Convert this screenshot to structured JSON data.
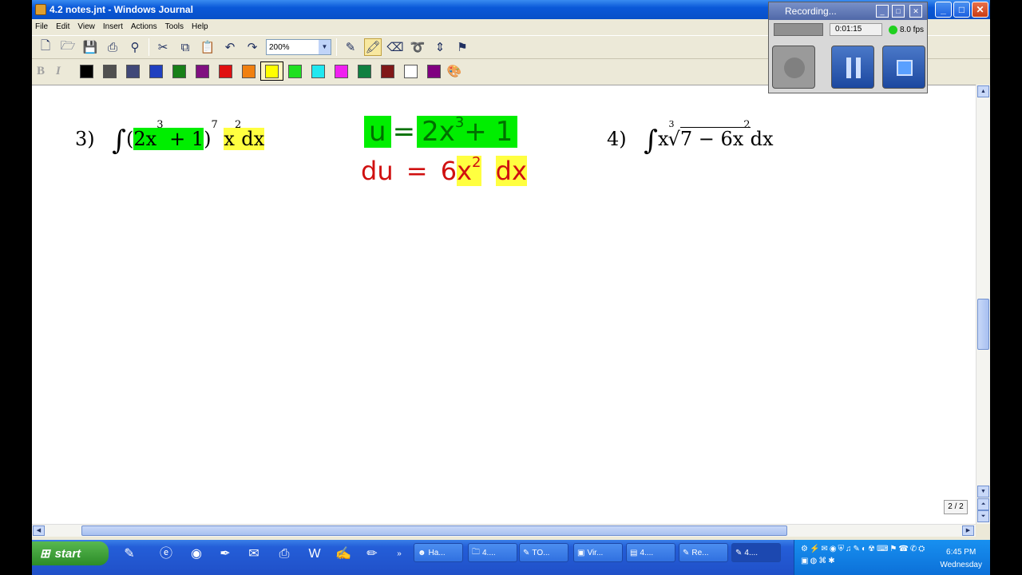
{
  "window": {
    "title": "4.2 notes.jnt - Windows Journal"
  },
  "menu": [
    "File",
    "Edit",
    "View",
    "Insert",
    "Actions",
    "Tools",
    "Help"
  ],
  "toolbar": {
    "zoom": "200%"
  },
  "palette": [
    "#000000",
    "#505050",
    "#404878",
    "#2040c0",
    "#188018",
    "#801080",
    "#e01010",
    "#f08010",
    "#ffff00",
    "#20e020",
    "#20e8f0",
    "#f020f0",
    "#108040",
    "#801818",
    "#ffffff",
    "#800080"
  ],
  "document": {
    "problem3": {
      "label": "3)",
      "integral_sign": "∫",
      "open_paren": "(",
      "inner_a": "2x",
      "inner_exp": "3",
      "inner_b": " + 1",
      "close_paren": ")",
      "power": "7",
      "factor_base": "x",
      "factor_exp": "2",
      "dx": "dx"
    },
    "sub_u": {
      "lhs": "u",
      "eq": "=",
      "rhs_a": "2x",
      "rhs_exp": "3",
      "rhs_b": "+ 1"
    },
    "sub_du": {
      "lhs": "du",
      "eq": "=",
      "coef": "6",
      "var": "x",
      "var_exp": "2",
      "dx": "dx"
    },
    "problem4": {
      "label": "4)",
      "integral_sign": "∫",
      "x": "x",
      "root_index": "3",
      "radical": "√",
      "radicand_a": "7 − 6x",
      "radicand_exp": "2",
      "dx": "dx"
    },
    "page_indicator": "2 / 2"
  },
  "recorder": {
    "title": "Recording...",
    "time": "0:01:15",
    "fps": "8.0 fps"
  },
  "taskbar": {
    "start": "start",
    "tasks": [
      "Ha...",
      "4....",
      "TO...",
      "Vir...",
      "4....",
      "Re...",
      "4...."
    ],
    "clock_time": "6:45 PM",
    "clock_day": "Wednesday"
  },
  "colors": {
    "highlight_green": "#00ee00",
    "highlight_yellow": "#ffff40",
    "ink_red": "#d01010",
    "ink_green": "#009000"
  }
}
